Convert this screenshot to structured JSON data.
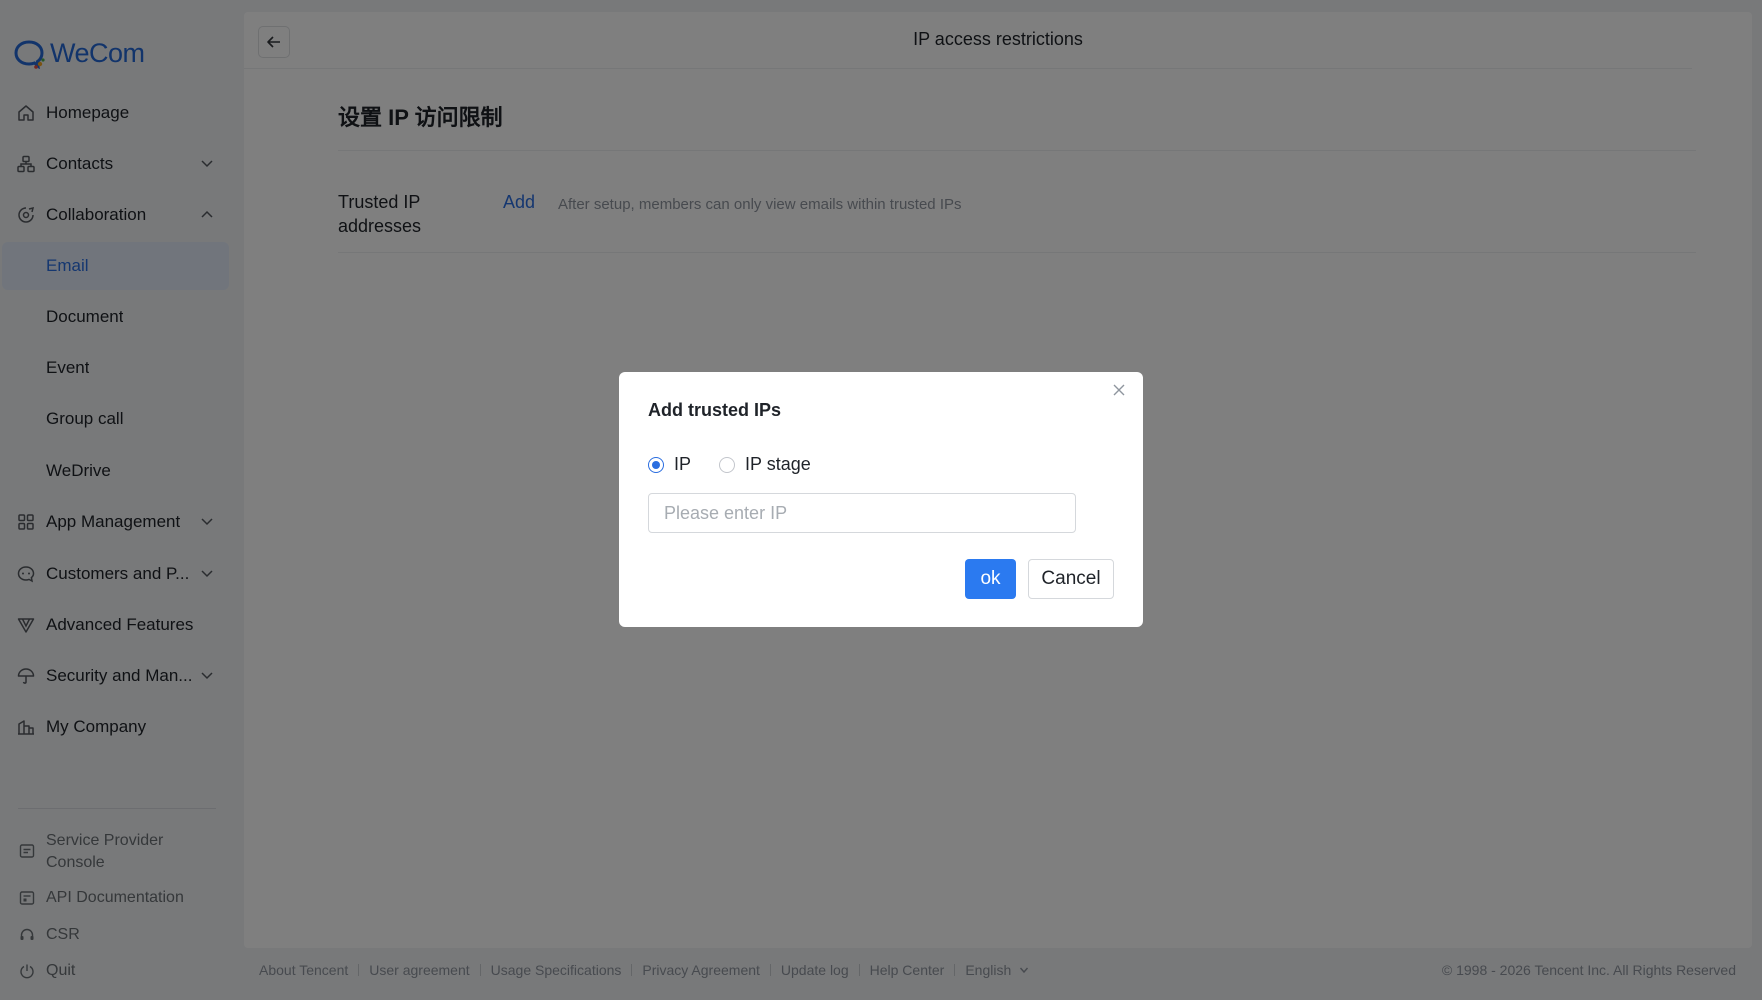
{
  "brand": {
    "name": "WeCom",
    "accent": "#2b6ee0"
  },
  "sidebar": {
    "items": [
      {
        "label": "Homepage",
        "icon": "home-icon"
      },
      {
        "label": "Contacts",
        "icon": "org-chart-icon",
        "expand": "chevron-down-icon"
      },
      {
        "label": "Collaboration",
        "icon": "collaboration-icon",
        "expand": "chevron-up-icon"
      },
      {
        "label": "Email",
        "active": true
      },
      {
        "label": "Document"
      },
      {
        "label": "Event"
      },
      {
        "label": "Group call"
      },
      {
        "label": "WeDrive"
      },
      {
        "label": "App Management",
        "icon": "apps-grid-icon",
        "expand": "chevron-down-icon"
      },
      {
        "label": "Customers and P...",
        "icon": "chat-bubble-icon",
        "expand": "chevron-down-icon"
      },
      {
        "label": "Advanced Features",
        "icon": "advanced-features-icon"
      },
      {
        "label": "Security and Man...",
        "icon": "umbrella-icon",
        "expand": "chevron-down-icon"
      },
      {
        "label": "My Company",
        "icon": "building-icon"
      }
    ],
    "bottom": [
      {
        "label": "Service Provider Console",
        "icon": "console-icon"
      },
      {
        "label": "API Documentation",
        "icon": "api-doc-icon"
      },
      {
        "label": "CSR",
        "icon": "headset-icon"
      },
      {
        "label": "Quit",
        "icon": "power-icon"
      }
    ]
  },
  "header": {
    "title": "IP access restrictions"
  },
  "main": {
    "section_title": "设置 IP 访问限制",
    "field_label": "Trusted IP addresses",
    "add_link": "Add",
    "hint": "After setup, members can only view emails within trusted IPs"
  },
  "footer": {
    "links": [
      "About Tencent",
      "User agreement",
      "Usage Specifications",
      "Privacy Agreement",
      "Update log",
      "Help Center"
    ],
    "language": "English",
    "copyright": "© 1998 - 2026 Tencent Inc. All Rights Reserved"
  },
  "modal": {
    "title": "Add trusted IPs",
    "options": [
      {
        "label": "IP",
        "checked": true
      },
      {
        "label": "IP stage",
        "checked": false
      }
    ],
    "input": {
      "value": "",
      "placeholder": "Please enter IP"
    },
    "ok_label": "ok",
    "cancel_label": "Cancel"
  }
}
